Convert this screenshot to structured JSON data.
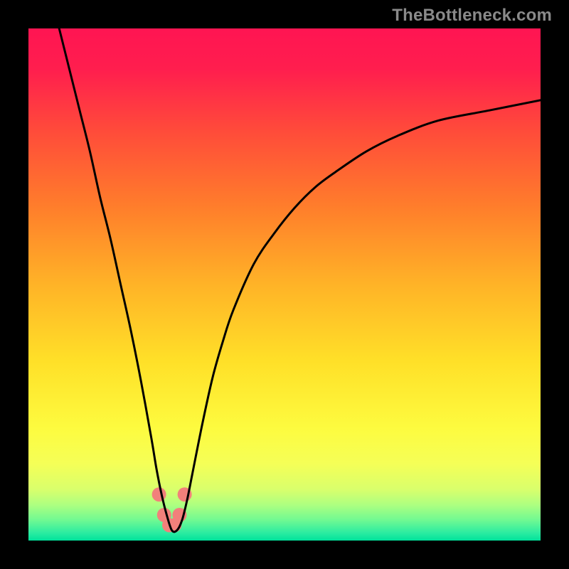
{
  "watermark": {
    "text": "TheBottleneck.com"
  },
  "chart_data": {
    "type": "line",
    "title": "",
    "xlabel": "",
    "ylabel": "",
    "xlim": [
      0,
      100
    ],
    "ylim": [
      0,
      100
    ],
    "legend": false,
    "grid": false,
    "background_gradient": {
      "direction": "vertical",
      "stops": [
        {
          "pos": 0.0,
          "color": "#ff1552"
        },
        {
          "pos": 0.08,
          "color": "#ff1e4e"
        },
        {
          "pos": 0.2,
          "color": "#ff4b3a"
        },
        {
          "pos": 0.35,
          "color": "#ff7e2b"
        },
        {
          "pos": 0.5,
          "color": "#ffb327"
        },
        {
          "pos": 0.65,
          "color": "#ffe028"
        },
        {
          "pos": 0.78,
          "color": "#fdfb3f"
        },
        {
          "pos": 0.85,
          "color": "#f5ff57"
        },
        {
          "pos": 0.9,
          "color": "#d9ff6c"
        },
        {
          "pos": 0.93,
          "color": "#aeff80"
        },
        {
          "pos": 0.96,
          "color": "#70f992"
        },
        {
          "pos": 0.985,
          "color": "#2beca1"
        },
        {
          "pos": 1.0,
          "color": "#00e29b"
        }
      ]
    },
    "series": [
      {
        "name": "bottleneck-curve",
        "color": "#000000",
        "x": [
          6,
          8,
          10,
          12,
          14,
          16,
          18,
          20,
          22,
          24,
          25,
          26,
          27,
          28,
          29,
          30,
          31,
          32,
          34,
          36,
          38,
          40,
          44,
          48,
          52,
          56,
          60,
          66,
          72,
          80,
          90,
          100
        ],
        "y": [
          100,
          92,
          84,
          76,
          67,
          59,
          50,
          41,
          31,
          20,
          14,
          9,
          5,
          2,
          2,
          4,
          8,
          13,
          23,
          32,
          39,
          45,
          54,
          60,
          65,
          69,
          72,
          76,
          79,
          82,
          84,
          86
        ]
      }
    ],
    "markers": {
      "name": "trough-band",
      "color": "#f2807b",
      "radius_px": 10,
      "points": [
        {
          "x": 25.5,
          "y": 9
        },
        {
          "x": 26.5,
          "y": 5
        },
        {
          "x": 27.5,
          "y": 3
        },
        {
          "x": 28.5,
          "y": 3
        },
        {
          "x": 29.5,
          "y": 5
        },
        {
          "x": 30.5,
          "y": 9
        }
      ]
    }
  }
}
